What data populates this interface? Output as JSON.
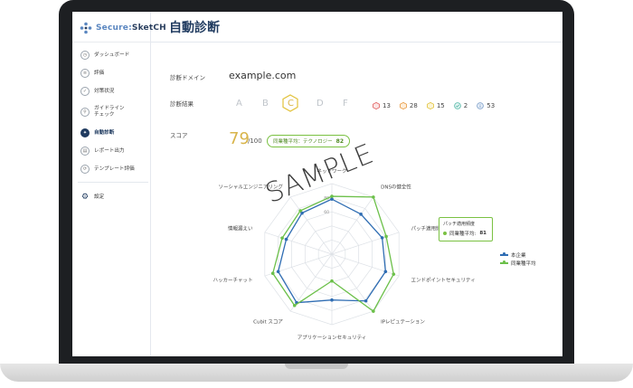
{
  "brand": {
    "name_a": "Secure",
    "name_b": "SketCH"
  },
  "sidebar": {
    "items": [
      {
        "label": "ダッシュボード",
        "icon": "dashboard-icon"
      },
      {
        "label": "評価",
        "icon": "evaluation-icon"
      },
      {
        "label": "対策状況",
        "icon": "check-icon"
      },
      {
        "label": "ガイドライン\nチェック",
        "icon": "guideline-icon"
      },
      {
        "label": "自動診断",
        "icon": "auto-diagnosis-icon",
        "active": true
      },
      {
        "label": "レポート出力",
        "icon": "report-icon"
      },
      {
        "label": "テンプレート評価",
        "icon": "template-icon"
      }
    ],
    "settings": {
      "label": "設定",
      "icon": "gear-icon"
    }
  },
  "page": {
    "title": "自動診断"
  },
  "diagnosis": {
    "domain_label": "診断ドメイン",
    "domain_value": "example.com",
    "result_label": "診断結果",
    "grades": [
      "A",
      "B",
      "C",
      "D",
      "F"
    ],
    "selected_grade": "C",
    "counts": [
      {
        "value": "13",
        "color": "#e05a5a",
        "icon": "critical-hex-icon"
      },
      {
        "value": "28",
        "color": "#e8963a",
        "icon": "high-hex-icon"
      },
      {
        "value": "15",
        "color": "#e2c23a",
        "icon": "medium-hex-icon"
      },
      {
        "value": "2",
        "color": "#52b7a6",
        "icon": "low-check-icon"
      },
      {
        "value": "53",
        "color": "#7a9cc6",
        "icon": "info-icon"
      }
    ],
    "score_label": "スコア",
    "score": "79",
    "score_max": "/100",
    "industry_avg_label": "同業種平均：テクノロジー",
    "industry_avg_value": "82"
  },
  "watermark": "SAMPLE",
  "tooltip": {
    "title": "パッチ適用頻度",
    "series": "同業種平均:",
    "value": "81"
  },
  "colors": {
    "company": "#2f6db3",
    "industry": "#6cc04a",
    "accent": "#1f3a5f"
  },
  "chart_data": {
    "type": "radar",
    "axes": [
      "ネットワーク",
      "DNSの健全性",
      "パッチ適用頻度",
      "エンドポイントセキュリティ",
      "IPレピュテーション",
      "アプリケーションセキュリティ",
      "Cubit スコア",
      "ハッカーチャット",
      "情報漏えい",
      "ソーシャルエンジニアリング"
    ],
    "tick_labels": [
      "60",
      "80"
    ],
    "range": [
      0,
      100
    ],
    "series": [
      {
        "name": "本企業",
        "color": "#2f6db3",
        "values": [
          78,
          70,
          75,
          80,
          82,
          65,
          85,
          80,
          68,
          72
        ]
      },
      {
        "name": "同業種平均",
        "color": "#6cc04a",
        "values": [
          82,
          100,
          81,
          92,
          100,
          38,
          90,
          88,
          74,
          76
        ]
      }
    ]
  }
}
